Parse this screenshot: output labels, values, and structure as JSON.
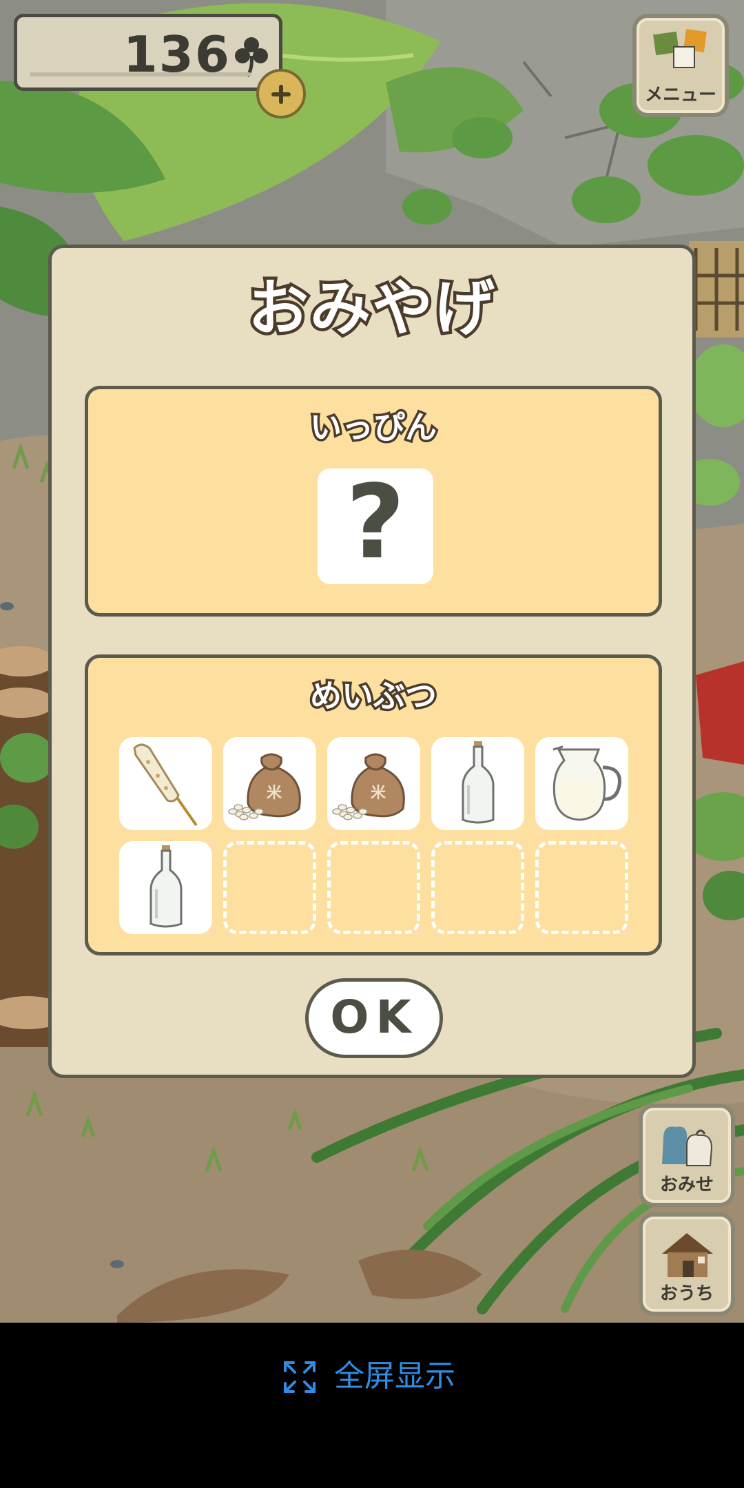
{
  "hud": {
    "clover_count": "136",
    "menu_label": "メニュー",
    "shop_label": "おみせ",
    "home_label": "おうち"
  },
  "dialog": {
    "title": "おみやげ",
    "special_title": "いっぴん",
    "special_item": "?",
    "local_title": "めいぶつ",
    "local_items": [
      {
        "icon": "skewer-icon"
      },
      {
        "icon": "rice-bag-icon"
      },
      {
        "icon": "rice-bag-icon"
      },
      {
        "icon": "glass-bottle-icon"
      },
      {
        "icon": "milk-jug-icon"
      },
      {
        "icon": "glass-bottle-icon"
      }
    ],
    "empty_slot_count": 4,
    "ok_label": "OK"
  },
  "system_bar": {
    "fullscreen_label": "全屏显示"
  },
  "colors": {
    "dialog_bg": "#e8dfc2",
    "panel_bg": "#fde0a0",
    "outline": "#5b5a4d",
    "fullscreen_blue": "#2f8de4"
  }
}
